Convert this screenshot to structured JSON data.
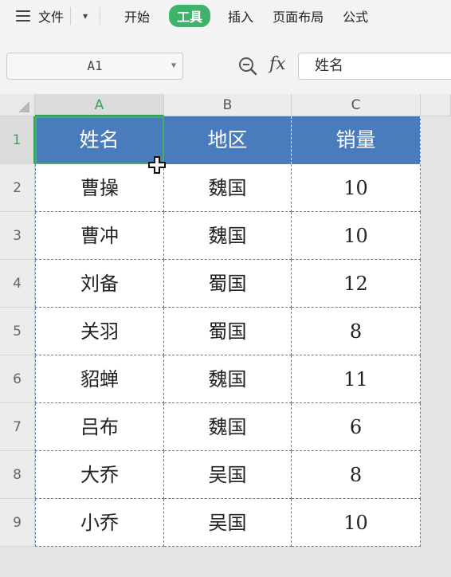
{
  "menubar": {
    "file_label": "文件",
    "dropdown_glyph": "▾",
    "tabs": [
      {
        "label": "开始",
        "active": false
      },
      {
        "label": "工具",
        "active": true
      },
      {
        "label": "插入",
        "active": false
      },
      {
        "label": "页面布局",
        "active": false
      },
      {
        "label": "公式",
        "active": false
      }
    ]
  },
  "formulabar": {
    "name_box": "A1",
    "fx_label": "fx",
    "formula_value": "姓名"
  },
  "grid": {
    "columns": [
      "A",
      "B",
      "C"
    ],
    "selected_column": "A",
    "rows": [
      "1",
      "2",
      "3",
      "4",
      "5",
      "6",
      "7",
      "8",
      "9"
    ],
    "selected_row": "1",
    "active_cell": "A1",
    "header_color": "#4a7cbd",
    "cells": [
      [
        "姓名",
        "地区",
        "销量"
      ],
      [
        "曹操",
        "魏国",
        "10"
      ],
      [
        "曹冲",
        "魏国",
        "10"
      ],
      [
        "刘备",
        "蜀国",
        "12"
      ],
      [
        "关羽",
        "蜀国",
        "8"
      ],
      [
        "貂蝉",
        "魏国",
        "11"
      ],
      [
        "吕布",
        "魏国",
        "6"
      ],
      [
        "大乔",
        "吴国",
        "8"
      ],
      [
        "小乔",
        "吴国",
        "10"
      ]
    ]
  },
  "colors": {
    "accent": "#3fb26b",
    "table_header": "#4a7cbd",
    "gridline": "#4a7fc1"
  }
}
